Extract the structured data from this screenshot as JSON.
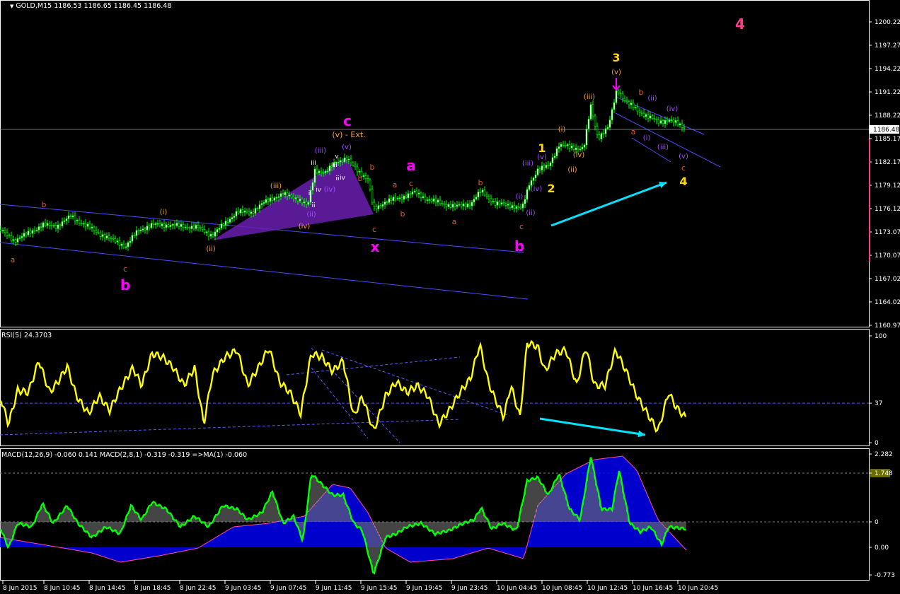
{
  "main_panel": {
    "symbol_header": "GOLD,M15  1186.53 1186.65 1186.45 1186.48",
    "current_price": "1186.48",
    "y_ticks": [
      "1200.22",
      "1197.27",
      "1194.22",
      "1191.22",
      "1188.22",
      "1185.17",
      "1182.17",
      "1179.12",
      "1176.12",
      "1173.07",
      "1170.07",
      "1167.02",
      "1164.02",
      "1160.97"
    ],
    "wave_labels": [
      {
        "text": "4",
        "color": "#ff3c8c",
        "size": 20
      },
      {
        "text": "3",
        "color": "#ffd600",
        "size": 16
      },
      {
        "text": "(v)",
        "color": "#ffa040",
        "size": 10
      },
      {
        "text": "b",
        "color": "#e05a2a",
        "size": 11
      },
      {
        "text": "(ii)",
        "color": "#a050ff",
        "size": 10
      },
      {
        "text": "(iv)",
        "color": "#a050ff",
        "size": 10
      },
      {
        "text": "(iii)",
        "color": "#ffa040",
        "size": 10
      },
      {
        "text": "a",
        "color": "#e05a2a",
        "size": 11
      },
      {
        "text": "(i)",
        "color": "#a050ff",
        "size": 10
      },
      {
        "text": "(iii)",
        "color": "#a050ff",
        "size": 10
      },
      {
        "text": "(v)",
        "color": "#a050ff",
        "size": 10
      },
      {
        "text": "c",
        "color": "#e05a2a",
        "size": 11
      },
      {
        "text": "4",
        "color": "#ffd600",
        "size": 16
      },
      {
        "text": "(i)",
        "color": "#ffa040",
        "size": 10
      },
      {
        "text": "(iv)",
        "color": "#ffa040",
        "size": 10
      },
      {
        "text": "(ii)",
        "color": "#ffa040",
        "size": 10
      },
      {
        "text": "1",
        "color": "#ffd600",
        "size": 16
      },
      {
        "text": "(v)",
        "color": "#a050ff",
        "size": 10
      },
      {
        "text": "(iii)",
        "color": "#a050ff",
        "size": 10
      },
      {
        "text": "(iv)",
        "color": "#a050ff",
        "size": 10
      },
      {
        "text": "2",
        "color": "#ffd600",
        "size": 16
      },
      {
        "text": "(i)",
        "color": "#a050ff",
        "size": 10
      },
      {
        "text": "(ii)",
        "color": "#a050ff",
        "size": 10
      },
      {
        "text": "c",
        "color": "#e05a2a",
        "size": 11
      },
      {
        "text": "b",
        "color": "#ff00ff",
        "size": 20
      },
      {
        "text": "b",
        "color": "#e05a2a",
        "size": 11
      },
      {
        "text": "a",
        "color": "#e05a2a",
        "size": 11
      },
      {
        "text": "a",
        "color": "#ff00ff",
        "size": 20
      },
      {
        "text": "c",
        "color": "#e05a2a",
        "size": 11
      },
      {
        "text": "a",
        "color": "#e05a2a",
        "size": 11
      },
      {
        "text": "b",
        "color": "#e05a2a",
        "size": 11
      },
      {
        "text": "b",
        "color": "#e05a2a",
        "size": 11
      },
      {
        "text": "b",
        "color": "#e05a2a",
        "size": 11
      },
      {
        "text": "c",
        "color": "#e05a2a",
        "size": 11
      },
      {
        "text": "x",
        "color": "#ff00ff",
        "size": 20
      },
      {
        "text": "c",
        "color": "#ff00ff",
        "size": 20
      },
      {
        "text": "(v) - Ext.",
        "color": "#ffa040",
        "size": 11
      },
      {
        "text": "(v)",
        "color": "#a050ff",
        "size": 10
      },
      {
        "text": "(iii)",
        "color": "#a050ff",
        "size": 10
      },
      {
        "text": "v",
        "color": "#ffffff",
        "size": 9
      },
      {
        "text": "iii",
        "color": "#ffffff",
        "size": 9
      },
      {
        "text": "iii",
        "color": "#ffffff",
        "size": 9
      },
      {
        "text": "iv",
        "color": "#ffffff",
        "size": 9
      },
      {
        "text": "ii",
        "color": "#ffffff",
        "size": 9
      },
      {
        "text": "iv",
        "color": "#ffffff",
        "size": 9
      },
      {
        "text": "(iv)",
        "color": "#a050ff",
        "size": 10
      },
      {
        "text": "i",
        "color": "#ffffff",
        "size": 9
      },
      {
        "text": "ii",
        "color": "#ffffff",
        "size": 9
      },
      {
        "text": "(ii)",
        "color": "#a050ff",
        "size": 10
      },
      {
        "text": "(iii)",
        "color": "#ffa040",
        "size": 10
      },
      {
        "text": "(iv)",
        "color": "#ffa040",
        "size": 10
      },
      {
        "text": "(i)",
        "color": "#ffa040",
        "size": 10
      },
      {
        "text": "(ii)",
        "color": "#ffa040",
        "size": 10
      },
      {
        "text": "b",
        "color": "#e05a2a",
        "size": 11
      },
      {
        "text": "a",
        "color": "#e05a2a",
        "size": 11
      },
      {
        "text": "c",
        "color": "#e05a2a",
        "size": 11
      },
      {
        "text": "b",
        "color": "#ff00ff",
        "size": 20
      }
    ]
  },
  "rsi_panel": {
    "header": "RSI(5) 24.3703",
    "y_ticks": [
      "100",
      "37",
      "0"
    ]
  },
  "macd_panel": {
    "header": "MACD(12,26,9) -0.060 0.141  MACD(2,8,1) -0.319 -0.319  =>MA(1) -0.060",
    "y_ticks": [
      "2.282",
      "1.748",
      "0",
      "0.00",
      "-0.773"
    ]
  },
  "time_axis": [
    "8 Jun 2015",
    "8 Jun 10:45",
    "8 Jun 14:45",
    "8 Jun 18:45",
    "8 Jun 22:45",
    "9 Jun 03:45",
    "9 Jun 07:45",
    "9 Jun 11:45",
    "9 Jun 15:45",
    "9 Jun 19:45",
    "9 Jun 23:45",
    "10 Jun 04:45",
    "10 Jun 08:45",
    "10 Jun 12:45",
    "10 Jun 16:45",
    "10 Jun 20:45"
  ],
  "colors": {
    "background": "#000000",
    "grid_frame": "#ffffff",
    "candles": "#00ff00",
    "channel": "#4b4bff",
    "rsi_line": "#ffff00",
    "macd_line": "#00ff00",
    "macd_fill": "#0000ff",
    "arrow": "#00e5ff",
    "triangle": "#6a1fb0"
  },
  "chart_data": [
    {
      "type": "candlestick",
      "title": "GOLD,M15",
      "ylim": [
        1160.97,
        1202.0
      ],
      "x": [
        "8 Jun 2015",
        "8 Jun 10:45",
        "8 Jun 14:45",
        "8 Jun 18:45",
        "8 Jun 22:45",
        "9 Jun 03:45",
        "9 Jun 07:45",
        "9 Jun 11:45",
        "9 Jun 15:45",
        "9 Jun 19:45",
        "9 Jun 23:45",
        "10 Jun 04:45",
        "10 Jun 08:45",
        "10 Jun 12:45",
        "10 Jun 16:45",
        "10 Jun 20:45"
      ],
      "series": [
        {
          "values": [
            1172.8,
            1174.2,
            1172.5,
            1175.0,
            1173.2,
            1175.8,
            1178.0,
            1182.5,
            1176.5,
            1177.5,
            1177.0,
            1176.5,
            1185.0,
            1190.5,
            1188.0,
            1186.48
          ]
        }
      ]
    },
    {
      "type": "line",
      "title": "RSI(5) 24.3703",
      "ylim": [
        0,
        100
      ],
      "series": [
        {
          "values": [
            45,
            60,
            65,
            40,
            70,
            55,
            72,
            30,
            60,
            75,
            50,
            35,
            70,
            50,
            90,
            45,
            70,
            85,
            25
          ]
        }
      ]
    },
    {
      "type": "area",
      "title": "MACD(12,26,9) -0.060 0.141",
      "ylim": [
        -0.773,
        2.282
      ],
      "series": [
        {
          "values": [
            0.0,
            -0.3,
            -0.5,
            -0.2,
            0.3,
            0.1,
            0.2,
            1.2,
            0.5,
            -0.4,
            -0.3,
            -0.5,
            0.8,
            2.0,
            1.0,
            -0.06
          ]
        }
      ]
    }
  ]
}
